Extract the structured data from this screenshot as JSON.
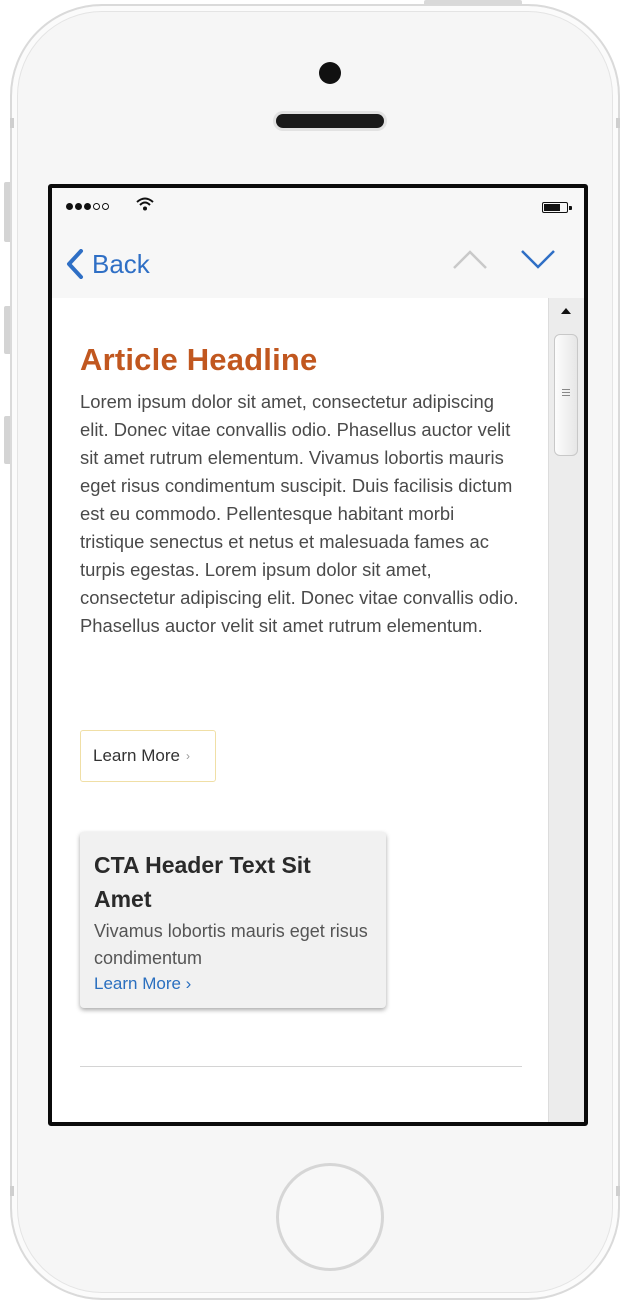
{
  "status_bar": {
    "signal_icon": "signal-dots-icon",
    "wifi_icon": "wifi-icon",
    "battery_icon": "battery-icon"
  },
  "nav": {
    "back_label": "Back",
    "back_icon": "chevron-left-icon",
    "prev_icon": "chevron-up-icon",
    "next_icon": "chevron-down-icon"
  },
  "article": {
    "headline": "Article Headline",
    "body": "Lorem ipsum dolor sit amet, consectetur adipiscing elit. Donec vitae convallis odio. Phasellus auctor velit sit amet rutrum elementum. Vivamus lobortis mauris eget risus condimentum suscipit. Duis facilisis dictum est eu commodo. Pellentesque habitant morbi tristique senectus et netus et malesuada fames ac turpis egestas. Lorem ipsum dolor sit amet, consectetur adipiscing elit. Donec vitae convallis odio. Phasellus auctor velit sit amet rutrum elementum.",
    "learn_more_label": "Learn More",
    "learn_more_chevron": "›"
  },
  "cta": {
    "title": "CTA Header Text Sit Amet",
    "body": "Vivamus lobortis mauris eget risus condimentum",
    "link_label": "Learn More ›"
  },
  "colors": {
    "headline": "#c1571f",
    "link": "#2f6fc5",
    "button_border": "#f0dfa6"
  }
}
